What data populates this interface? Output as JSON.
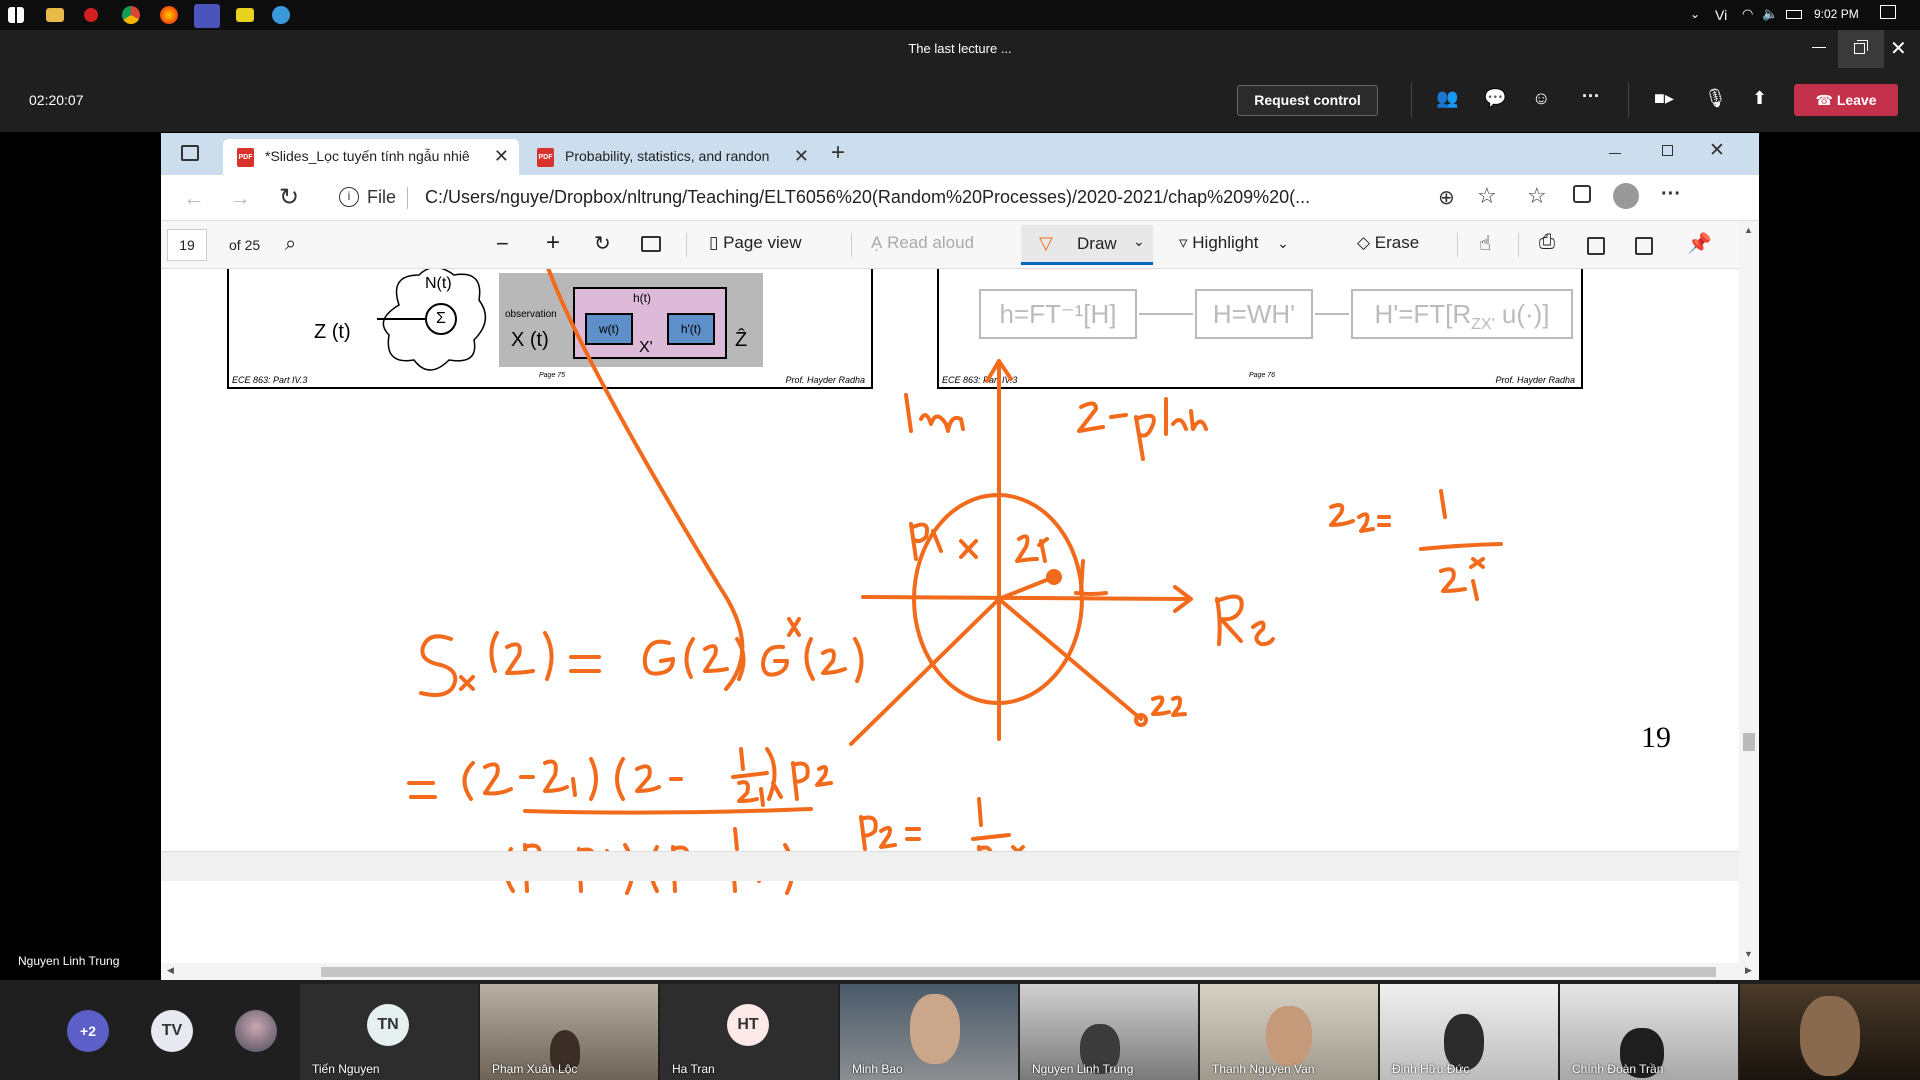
{
  "taskbar": {
    "language": "Vi",
    "time": "9:02 PM"
  },
  "window": {
    "title": "The last lecture ..."
  },
  "meeting": {
    "elapsed": "02:20:07",
    "request_control_label": "Request control",
    "leave_label": "Leave",
    "presenter_name": "Nguyen Linh Trung"
  },
  "browser": {
    "tabs": [
      {
        "label": "*Slides_Lọc tuyến tính ngẫu nhiê"
      },
      {
        "label": "Probability, statistics, and randon"
      }
    ],
    "file_label": "File",
    "url": "C:/Users/nguye/Dropbox/nltrung/Teaching/ELT6056%20(Random%20Processes)/2020-2021/chap%209%20(..."
  },
  "pdf_toolbar": {
    "page_number": "19",
    "page_total": "of 25",
    "page_view_label": "Page view",
    "read_aloud_label": "Read aloud",
    "draw_label": "Draw",
    "highlight_label": "Highlight",
    "erase_label": "Erase"
  },
  "slide": {
    "page_number": "19",
    "left_thumb": {
      "noise_label": "N(t)",
      "sum_label": "Σ",
      "input_label": "Z (t)",
      "observation_label": "observation",
      "x_label": "X (t)",
      "h_label": "h(t)",
      "w_label": "w(t)",
      "hprime_label": "h'(t)",
      "xprime_label": "X'",
      "zhat_label": "Ẑ",
      "footer_left": "ECE 863: Part IV.3",
      "footer_mid": "Page 75",
      "footer_right": "Prof. Hayder Radha"
    },
    "right_thumb": {
      "box1": "h=FT⁻¹[H]",
      "box2": "H=WH'",
      "box3": "H'=FT[R",
      "box3_sub": "ZX'",
      "box3_tail": " u(·)]",
      "footer_left": "ECE 863: Part IV.3",
      "footer_mid": "Page 76",
      "footer_right": "Prof. Hayder Radha"
    }
  },
  "participants": {
    "overflow_count": "+2",
    "avatars": [
      {
        "initials": "TV",
        "color": "#e8e8f0"
      },
      {
        "initials": "TN",
        "color": "#e6f0ee"
      },
      {
        "initials": "HT",
        "color": "#fde9e7"
      }
    ],
    "tiles": [
      {
        "name": "Tiến Nguyen"
      },
      {
        "name": "Phạm Xuân Lộc"
      },
      {
        "name": "Ha Tran"
      },
      {
        "name": "Minh Bao"
      },
      {
        "name": "Nguyen Linh Trung"
      },
      {
        "name": "Thanh Nguyen Van"
      },
      {
        "name": "Đinh Hữu Đức"
      },
      {
        "name": "Chính Đoàn Trần"
      }
    ]
  },
  "colors": {
    "ink": "#f26a1b",
    "leave": "#c4314b",
    "tab_bar": "#ccdded"
  }
}
